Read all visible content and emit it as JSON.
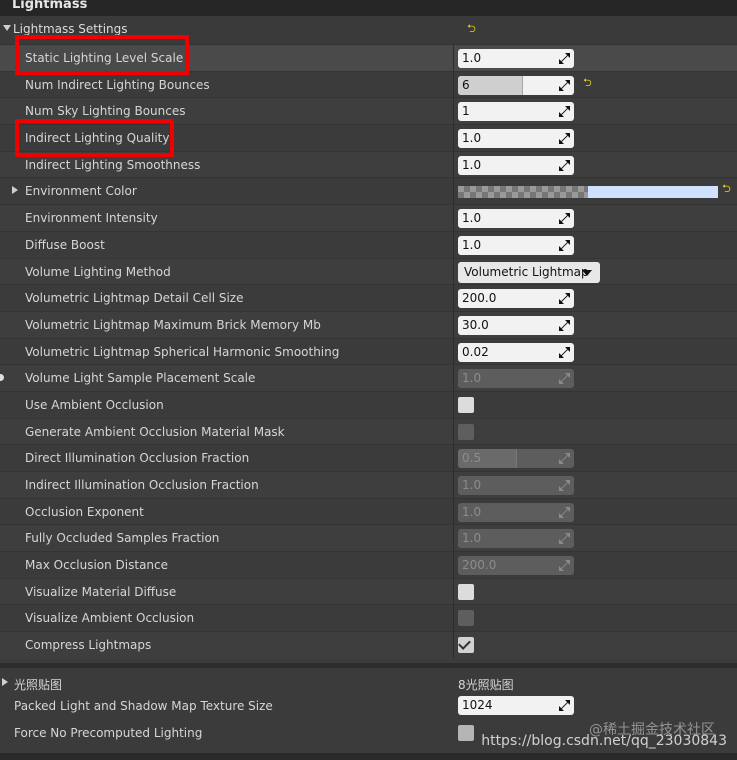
{
  "panel": {
    "title": "Lightmass"
  },
  "lightmass_settings": {
    "label": "Lightmass Settings"
  },
  "rows": [
    {
      "label": "Static Lighting Level Scale",
      "control": "number",
      "value": "1.0"
    },
    {
      "label": "Num Indirect Lighting Bounces",
      "control": "number",
      "value": "6",
      "fill_fraction": 0.55
    },
    {
      "label": "Num Sky Lighting Bounces",
      "control": "number",
      "value": "1"
    },
    {
      "label": "Indirect Lighting Quality",
      "control": "number",
      "value": "1.0"
    },
    {
      "label": "Indirect Lighting Smoothness",
      "control": "number",
      "value": "1.0"
    },
    {
      "label": "Environment Color",
      "control": "color",
      "color": "#cfe1ff"
    },
    {
      "label": "Environment Intensity",
      "control": "number",
      "value": "1.0"
    },
    {
      "label": "Diffuse Boost",
      "control": "number",
      "value": "1.0"
    },
    {
      "label": "Volume Lighting Method",
      "control": "dropdown",
      "value": "Volumetric Lightmap"
    },
    {
      "label": "Volumetric Lightmap Detail Cell Size",
      "control": "number",
      "value": "200.0"
    },
    {
      "label": "Volumetric Lightmap Maximum Brick Memory Mb",
      "control": "number",
      "value": "30.0"
    },
    {
      "label": "Volumetric Lightmap Spherical Harmonic Smoothing",
      "control": "number",
      "value": "0.02"
    },
    {
      "label": "Volume Light Sample Placement Scale",
      "control": "number",
      "value": "1.0",
      "disabled": true
    },
    {
      "label": "Use Ambient Occlusion",
      "control": "checkbox",
      "checked": false
    },
    {
      "label": "Generate Ambient Occlusion Material Mask",
      "control": "checkbox",
      "checked": false,
      "disabled": true
    },
    {
      "label": "Direct Illumination Occlusion Fraction",
      "control": "number",
      "value": "0.5",
      "disabled": true,
      "fill_fraction": 0.5
    },
    {
      "label": "Indirect Illumination Occlusion Fraction",
      "control": "number",
      "value": "1.0",
      "disabled": true
    },
    {
      "label": "Occlusion Exponent",
      "control": "number",
      "value": "1.0",
      "disabled": true
    },
    {
      "label": "Fully Occluded Samples Fraction",
      "control": "number",
      "value": "1.0",
      "disabled": true
    },
    {
      "label": "Max Occlusion Distance",
      "control": "number",
      "value": "200.0",
      "disabled": true
    },
    {
      "label": "Visualize Material Diffuse",
      "control": "checkbox",
      "checked": false
    },
    {
      "label": "Visualize Ambient Occlusion",
      "control": "checkbox",
      "checked": false,
      "disabled": true
    },
    {
      "label": "Compress Lightmaps",
      "control": "checkbox",
      "checked": true
    }
  ],
  "bottom": {
    "lightmaps_label": "光照贴图",
    "lightmaps_count": "8光照贴图",
    "packed_label": "Packed Light and Shadow Map Texture Size",
    "packed_value": "1024",
    "force_label": "Force No Precomputed Lighting"
  },
  "watermark": {
    "line1": "@稀土掘金技术社区",
    "line2": "https://blog.csdn.net/qq_23030843"
  },
  "colors": {
    "highlight": "#f10000",
    "reset_arrow": "#e6d21a"
  }
}
